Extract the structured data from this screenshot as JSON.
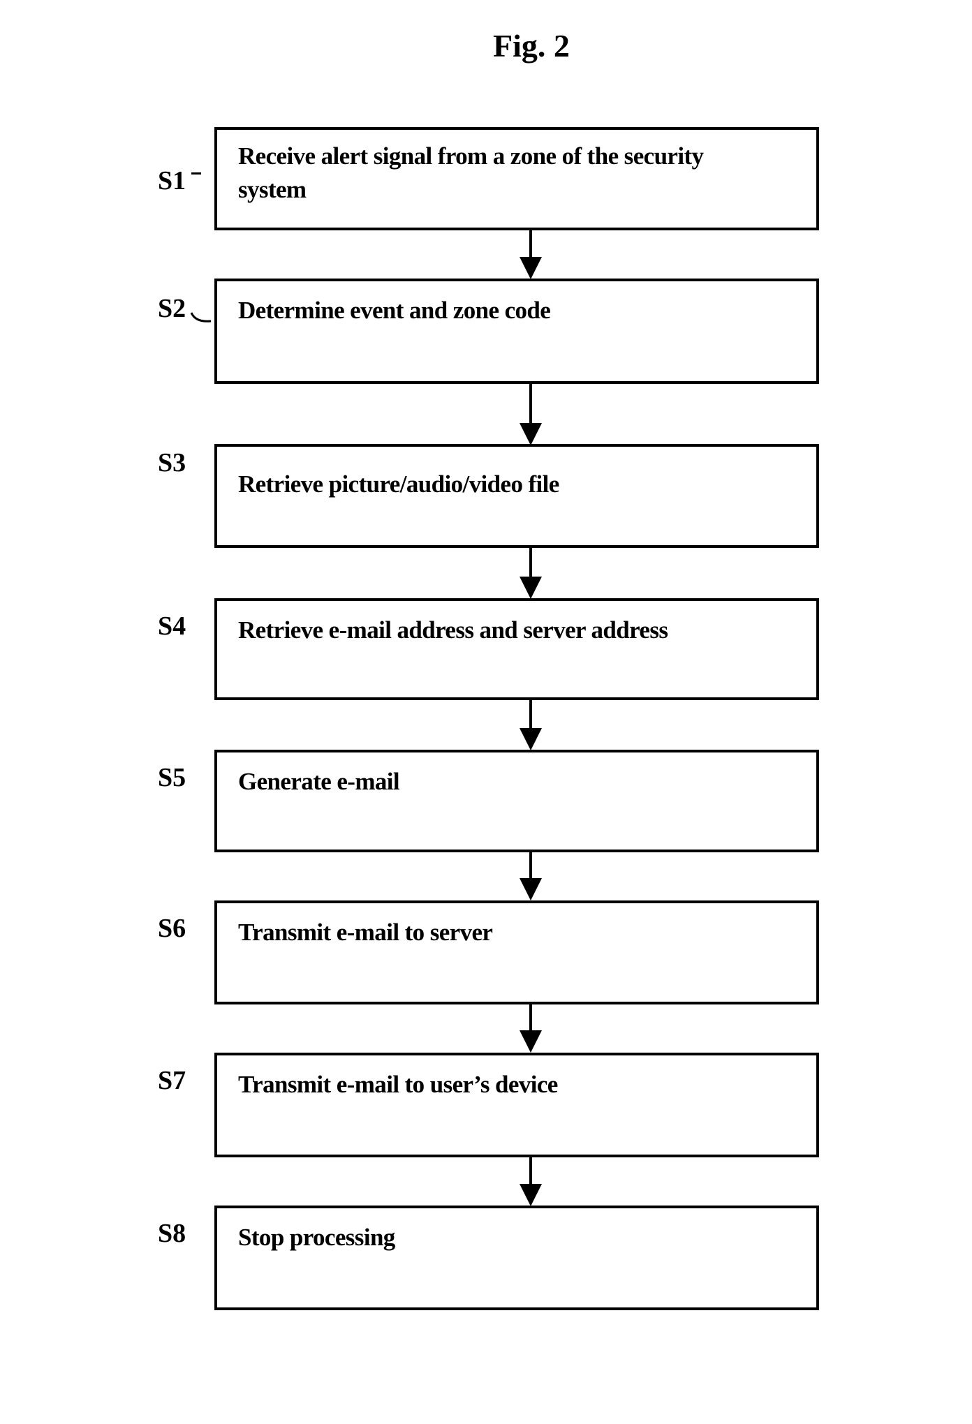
{
  "figure": {
    "title": "Fig. 2"
  },
  "steps": [
    {
      "label": "S1",
      "text": "Receive alert signal from a zone of the security system"
    },
    {
      "label": "S2",
      "text": "Determine event and zone code"
    },
    {
      "label": "S3",
      "text": "Retrieve picture/audio/video file"
    },
    {
      "label": "S4",
      "text": "Retrieve e-mail address and server address"
    },
    {
      "label": "S5",
      "text": "Generate e-mail"
    },
    {
      "label": "S6",
      "text": "Transmit e-mail to server"
    },
    {
      "label": "S7",
      "text": "Transmit e-mail to user’s device"
    },
    {
      "label": "S8",
      "text": "Stop processing"
    }
  ],
  "connections": [
    {
      "from": "S1",
      "to": "S2"
    },
    {
      "from": "S2",
      "to": "S3"
    },
    {
      "from": "S3",
      "to": "S4"
    },
    {
      "from": "S4",
      "to": "S5"
    },
    {
      "from": "S5",
      "to": "S6"
    },
    {
      "from": "S6",
      "to": "S7"
    },
    {
      "from": "S7",
      "to": "S8"
    }
  ]
}
